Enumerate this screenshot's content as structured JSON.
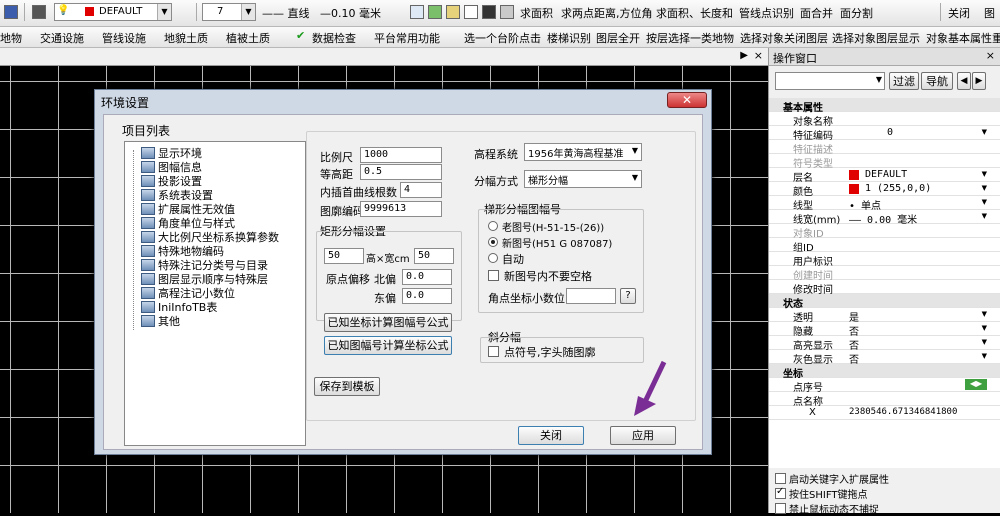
{
  "toolbar1": {
    "layer": "DEFAULT",
    "lineweight_num": "7",
    "linetype": "—— 直线",
    "lineweight": "—0.10 毫米",
    "buttons": [
      "求面积",
      "求两点距离,方位角",
      "求面积、长度和",
      "管线点识别",
      "面合并",
      "面分割"
    ],
    "close": "关闭",
    "extra": "图"
  },
  "toolbar2": {
    "items": [
      "地物",
      "交通设施",
      "管线设施",
      "地貌土质",
      "植被土质",
      "数据检查",
      "平台常用功能",
      "选一个台阶点击",
      "楼梯识别",
      "图层全开",
      "按层选择一类地物",
      "选择对象关闭图层",
      "选择对象图层显示",
      "对象基本属性重"
    ]
  },
  "dialog": {
    "title": "环境设置",
    "list_title": "项目列表",
    "tree": [
      "显示环境",
      "图幅信息",
      "投影设置",
      "系统表设置",
      "扩展属性无效值",
      "角度单位与样式",
      "大比例尺坐标系换算参数",
      "特殊地物编码",
      "特殊注记分类号与目录",
      "图层显示顺序与特殊层",
      "高程注记小数位",
      "IniInfoTB表",
      "其他"
    ],
    "scale_label": "比例尺",
    "scale": "1000",
    "contour_label": "等高距",
    "contour": "0.5",
    "inner_label": "内插首曲线根数",
    "inner": "4",
    "sheet_code_label": "图廓编码",
    "sheet_code": "9999613",
    "height_sys_label": "高程系统",
    "height_sys": "1956年黄海高程基准",
    "division_label": "分幅方式",
    "division": "梯形分幅",
    "rect_group": "矩形分幅设置",
    "rect_h": "50",
    "rect_hw_label": "高×宽cm",
    "rect_w": "50",
    "origin_label": "原点偏移",
    "north_label": "北偏",
    "north": "0.0",
    "east_label": "东偏",
    "east": "0.0",
    "btn_calc1": "已知坐标计算图幅号公式",
    "btn_calc2": "已知图幅号计算坐标公式",
    "trap_group": "梯形分幅图幅号",
    "radio_old": "老图号(H-51-15-(26))",
    "radio_new": "新图号(H51 G 087087)",
    "radio_auto": "自动",
    "chk_nospace": "新图号内不要空格",
    "corner_label": "角点坐标小数位",
    "corner_btn": "?",
    "oblique_group": "斜分幅",
    "chk_oblique": "点符号,字头随图廓",
    "save_tpl": "保存到模板",
    "btn_close": "关闭",
    "btn_apply": "应用"
  },
  "panel": {
    "title": "操作窗口",
    "filter": "过滤",
    "nav": "导航",
    "sections": [
      {
        "name": "基本属性",
        "rows": [
          {
            "k": "对象名称",
            "v": ""
          },
          {
            "k": "特征编码",
            "v": "0"
          },
          {
            "k": "特征描述",
            "v": "",
            "gray": true
          },
          {
            "k": "符号类型",
            "v": "",
            "gray": true
          },
          {
            "k": "层名",
            "v": "DEFAULT"
          },
          {
            "k": "颜色",
            "v": "1 (255,0,0)"
          },
          {
            "k": "线型",
            "v": "• 单点"
          },
          {
            "k": "线宽(mm)",
            "v": "—— 0.00 毫米"
          },
          {
            "k": "对象ID",
            "v": "",
            "gray": true
          },
          {
            "k": "组ID",
            "v": ""
          },
          {
            "k": "用户标识",
            "v": ""
          },
          {
            "k": "创建时间",
            "v": "",
            "gray": true
          },
          {
            "k": "修改时间",
            "v": ""
          }
        ]
      },
      {
        "name": "状态",
        "rows": [
          {
            "k": "透明",
            "v": "是"
          },
          {
            "k": "隐藏",
            "v": "否"
          },
          {
            "k": "高亮显示",
            "v": "否"
          },
          {
            "k": "灰色显示",
            "v": "否"
          }
        ]
      },
      {
        "name": "坐标",
        "rows": [
          {
            "k": "点序号",
            "v": ""
          },
          {
            "k": "点名称",
            "v": ""
          },
          {
            "k": "X",
            "v": "2380546.671346841800"
          }
        ]
      }
    ],
    "opts": [
      "启动关键字入扩展属性",
      "按住SHIFT键拖点",
      "禁止鼠标动态不捕捉"
    ]
  },
  "colors": {
    "layer_red": "#e00000",
    "title_blue": "#2a56b8"
  }
}
